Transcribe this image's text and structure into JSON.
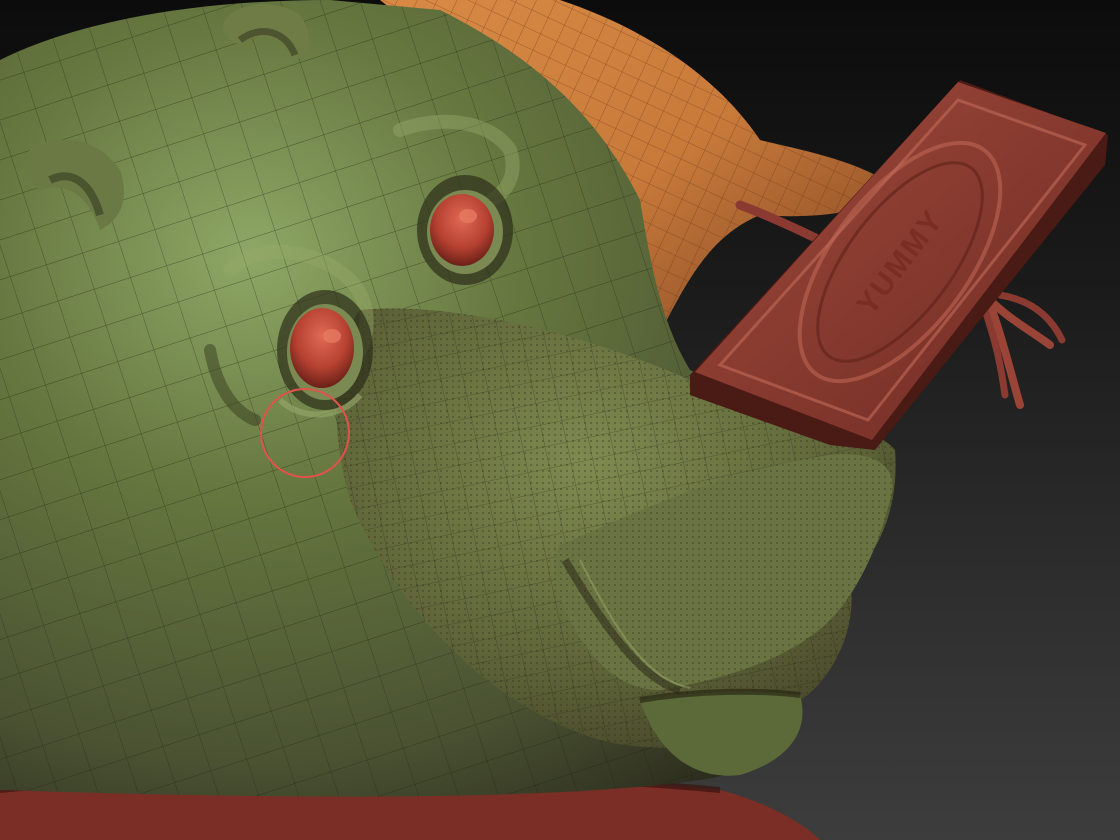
{
  "viewport": {
    "background_top": "#0c0c0c",
    "background_bottom": "#3d3d3d"
  },
  "model": {
    "skin_color": "#55653c",
    "skin_highlight": "#8ea766",
    "orange_body_color": "#c87a3a",
    "eye_color": "#b84232",
    "chocolate_color": "#8a3a30"
  },
  "chocolate_bar": {
    "embossed_text": "YUMMY"
  },
  "brush_cursor": {
    "color": "#e0534a"
  }
}
